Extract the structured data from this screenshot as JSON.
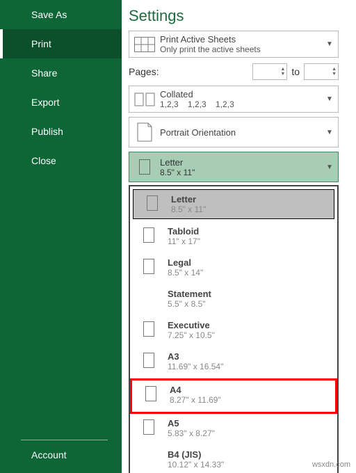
{
  "sidebar": {
    "items": [
      "Save As",
      "Print",
      "Share",
      "Export",
      "Publish",
      "Close"
    ],
    "activeIndex": 1,
    "bottom": "Account"
  },
  "title": "Settings",
  "printWhat": {
    "head": "Print Active Sheets",
    "sub": "Only print the active sheets"
  },
  "pages": {
    "label": "Pages:",
    "to": "to"
  },
  "collated": {
    "head": "Collated",
    "sub": "1,2,3    1,2,3    1,2,3"
  },
  "orient": {
    "head": "Portrait Orientation"
  },
  "paperSel": {
    "head": "Letter",
    "sub": "8.5\" x 11\""
  },
  "paperList": [
    {
      "name": "Letter",
      "dim": "8.5\" x 11\"",
      "icon": true
    },
    {
      "name": "Tabloid",
      "dim": "11\" x 17\"",
      "icon": true
    },
    {
      "name": "Legal",
      "dim": "8.5\" x 14\"",
      "icon": true
    },
    {
      "name": "Statement",
      "dim": "5.5\" x 8.5\"",
      "icon": false
    },
    {
      "name": "Executive",
      "dim": "7.25\" x 10.5\"",
      "icon": true
    },
    {
      "name": "A3",
      "dim": "11.69\" x 16.54\"",
      "icon": true
    },
    {
      "name": "A4",
      "dim": "8.27\" x 11.69\"",
      "icon": true
    },
    {
      "name": "A5",
      "dim": "5.83\" x 8.27\"",
      "icon": true
    },
    {
      "name": "B4 (JIS)",
      "dim": "10.12\" x 14.33\"",
      "icon": false
    }
  ],
  "highlightIndex": 6,
  "watermark": "wsxdn.com"
}
